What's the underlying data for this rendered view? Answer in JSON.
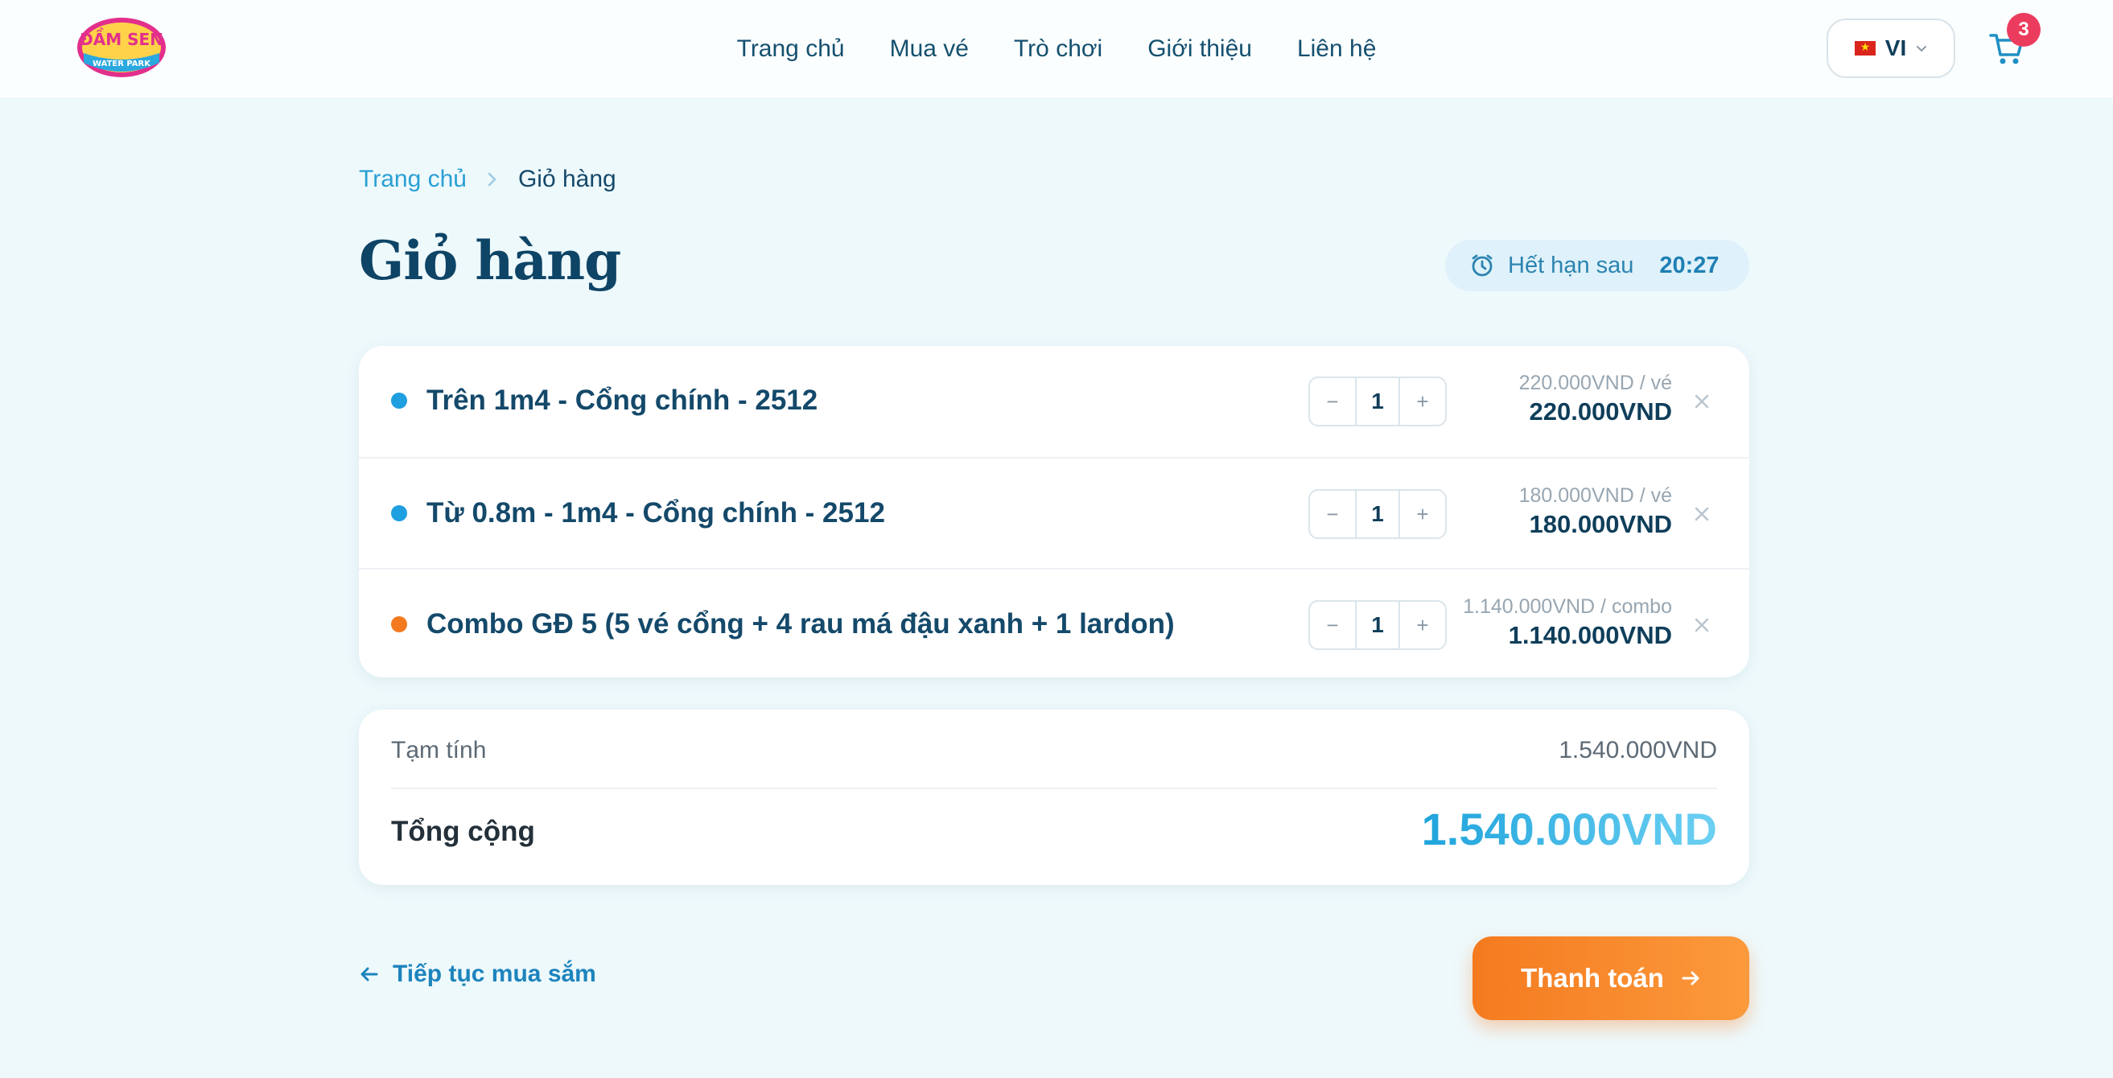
{
  "header": {
    "logo_alt": "ĐẦM SEN WATER PARK",
    "nav": [
      "Trang chủ",
      "Mua vé",
      "Trò chơi",
      "Giới thiệu",
      "Liên hệ"
    ],
    "language": "VI",
    "cart_count": "3"
  },
  "breadcrumb": {
    "home": "Trang chủ",
    "current": "Giỏ hàng"
  },
  "page_title": "Giỏ hàng",
  "timer": {
    "label": "Hết hạn sau",
    "value": "20:27"
  },
  "cart_items": [
    {
      "name": "Trên 1m4 - Cổng chính - 2512",
      "quantity": "1",
      "unit_price": "220.000VND / vé",
      "line_total": "220.000VND",
      "dot_color": "#1e9fe0"
    },
    {
      "name": "Từ 0.8m - 1m4 - Cổng chính - 2512",
      "quantity": "1",
      "unit_price": "180.000VND / vé",
      "line_total": "180.000VND",
      "dot_color": "#1e9fe0"
    },
    {
      "name": "Combo GĐ 5 (5 vé cổng + 4 rau má đậu xanh + 1 lardon)",
      "quantity": "1",
      "unit_price": "1.140.000VND / combo",
      "line_total": "1.140.000VND",
      "dot_color": "#f57a1f"
    }
  ],
  "controls": {
    "minus": "−",
    "plus": "+"
  },
  "summary": {
    "subtotal_label": "Tạm tính",
    "subtotal_value": "1.540.000VND",
    "total_label": "Tổng cộng",
    "total_value": "1.540.000VND"
  },
  "actions": {
    "continue_label": "Tiếp tục mua sắm",
    "checkout_label": "Thanh toán"
  },
  "colors": {
    "accent": "#1fa4dc",
    "checkout": "#f57a1f",
    "badge": "#ec3c5e"
  }
}
